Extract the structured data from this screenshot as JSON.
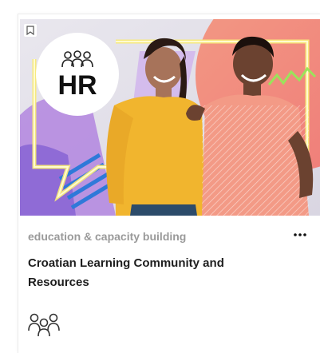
{
  "card": {
    "badge_text": "HR",
    "category": "education & capacity building",
    "title": "Croatian Learning Community and Resources",
    "icons": {
      "bookmark": "bookmark-icon",
      "group_badge": "group-icon",
      "more": "more-options-icon",
      "community": "community-icon"
    }
  },
  "colors": {
    "category_text": "#9a9a9a",
    "title_text": "#1e1e1e"
  }
}
